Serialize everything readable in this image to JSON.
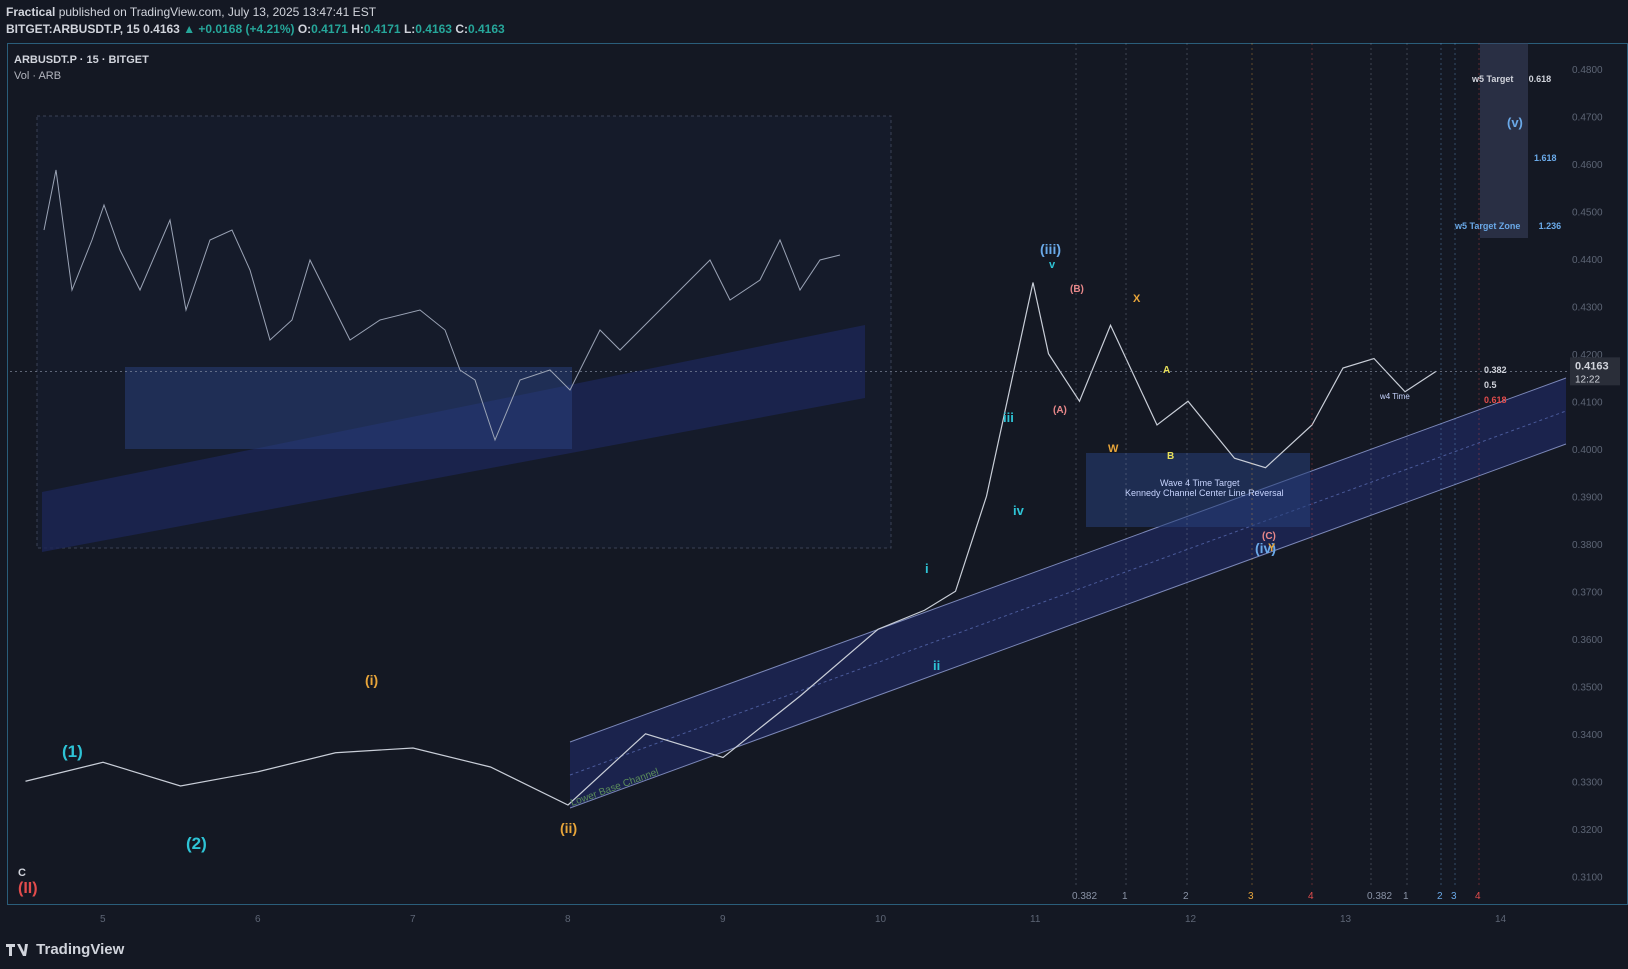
{
  "header": {
    "author": "Fractical",
    "published": "published on TradingView.com, July 13, 2025 13:47:41 EST",
    "symbol_line": "BITGET:ARBUSDT.P, 15",
    "open_value": "0.4163",
    "change": "▲ +0.0168 (+4.21%)",
    "o_label": "O:",
    "o": "0.4171",
    "h_label": "H:",
    "h": "0.4171",
    "l_label": "L:",
    "l": "0.4163",
    "c_label": "C:",
    "c": "0.4163"
  },
  "legend": {
    "title": "ARBUSDT.P · 15 · BITGET",
    "volume": "Vol · ARB"
  },
  "footer": {
    "brand": "TradingView"
  },
  "colors": {
    "background": "#141823",
    "channel_fill": "#1f2b5e",
    "price_line": "#c9ced8",
    "axis_text": "#5d6575",
    "cyan": "#2ec4d6",
    "orange": "#e8a53a",
    "red": "#e24c4c",
    "blue_label": "#6aa9e8",
    "price_badge": "#d1d4dc"
  },
  "chart_data": {
    "type": "line",
    "title": "ARBUSDT.P · 15 · BITGET",
    "xlabel": "",
    "ylabel": "",
    "x": [
      4.5,
      5.0,
      5.5,
      6.0,
      6.5,
      7.0,
      7.5,
      8.0,
      8.5,
      9.0,
      9.5,
      10.0,
      10.3,
      10.5,
      10.7,
      11.0,
      11.1,
      11.3,
      11.5,
      11.8,
      12.0,
      12.3,
      12.5,
      12.8,
      13.0,
      13.2,
      13.4,
      13.6
    ],
    "series": [
      {
        "values": [
          0.33,
          0.334,
          0.329,
          0.332,
          0.336,
          0.337,
          0.333,
          0.325,
          0.34,
          0.335,
          0.348,
          0.362,
          0.366,
          0.37,
          0.39,
          0.435,
          0.42,
          0.41,
          0.426,
          0.405,
          0.41,
          0.398,
          0.396,
          0.405,
          0.417,
          0.419,
          0.412,
          0.4163
        ]
      }
    ],
    "x_ticks": [
      "5",
      "6",
      "7",
      "8",
      "9",
      "10",
      "11",
      "12",
      "13",
      "14"
    ],
    "y_ticks": [
      "0.4800",
      "0.4700",
      "0.4600",
      "0.4500",
      "0.4400",
      "0.4300",
      "0.4200",
      "0.4100",
      "0.4000",
      "0.3900",
      "0.3800",
      "0.3700",
      "0.3600",
      "0.3500",
      "0.3400",
      "0.3300",
      "0.3200",
      "0.3100"
    ],
    "ylim": [
      0.305,
      0.485
    ],
    "current_price": "0.4163",
    "countdown": "12:22",
    "grid": false,
    "levels": [
      {
        "label": "w5 Target",
        "ratio": "0.618"
      },
      {
        "label": "",
        "ratio": "1.618"
      },
      {
        "label": "w5 Target Zone",
        "ratio": "1.236"
      },
      {
        "label": "",
        "ratio": "0.382"
      },
      {
        "label": "",
        "ratio": "0.5"
      },
      {
        "label": "",
        "ratio": "0.618"
      }
    ],
    "annotations": [
      "Wave 4 Time Target",
      "Kennedy Channel Center Line Reversal",
      "Lower Base Channel",
      "w4 Time"
    ],
    "wave_labels": [
      "(II)",
      "C",
      "(1)",
      "(2)",
      "(i)",
      "(ii)",
      "(iii)",
      "(iv)",
      "(v)",
      "iii",
      "iv",
      "i",
      "ii",
      "v",
      "(A)",
      "(B)",
      "(C)",
      "A",
      "B",
      "W",
      "X",
      "Y"
    ],
    "bottom_markers": [
      "0.382",
      "1",
      "2",
      "3",
      "4",
      "0.382",
      "1",
      "2",
      "3",
      "4"
    ]
  }
}
